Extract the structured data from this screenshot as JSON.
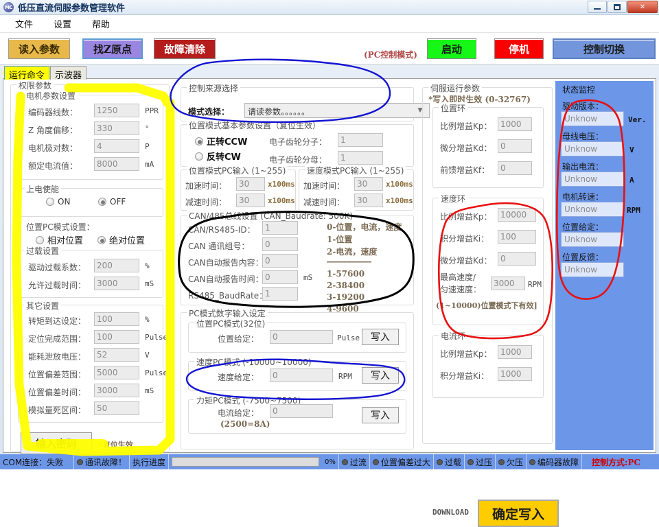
{
  "window": {
    "title": "低压直流伺服参数管理软件",
    "icon": "app-icon",
    "minimize": "–",
    "maximize": "□",
    "close": "✕"
  },
  "menu": {
    "items": [
      "文件",
      "设置",
      "帮助"
    ]
  },
  "toolbar": {
    "read_params": "读入参数",
    "find_z": "找Z原点",
    "fault_clear": "故障清除",
    "pc_mode_note": "(PC控制模式)",
    "start": "启动",
    "stop": "停机",
    "control_switch": "控制切换"
  },
  "tabs": [
    {
      "label": "运行命令",
      "active": true
    },
    {
      "label": "示波器",
      "active": false
    }
  ],
  "left": {
    "outer_caption": "权限参数",
    "motor": {
      "caption": "电机参数设置",
      "rows": [
        {
          "label": "编码器线数：",
          "value": "1250",
          "unit": "PPR"
        },
        {
          "label": "Z 角度偏移：",
          "value": "330",
          "unit": "°"
        },
        {
          "label": "电机极对数：",
          "value": "4",
          "unit": "P"
        },
        {
          "label": "额定电流值：",
          "value": "8000",
          "unit": "mA"
        }
      ]
    },
    "power_enable": {
      "caption": "上电使能",
      "on": "ON",
      "off": "OFF",
      "selected": "OFF",
      "pc_mode_label": "位置PC模式设置：",
      "relative": "相对位置",
      "absolute": "绝对位置",
      "pos_selected": "绝对位置"
    },
    "overload": {
      "caption": "过载设置",
      "rows": [
        {
          "label": "驱动过载系数：",
          "value": "200",
          "unit": "%"
        },
        {
          "label": "允许过载时间：",
          "value": "3000",
          "unit": "mS"
        }
      ]
    },
    "other": {
      "caption": "其它设置",
      "rows": [
        {
          "label": "转矩到达设定：",
          "value": "100",
          "unit": "%"
        },
        {
          "label": "定位完成范围：",
          "value": "100",
          "unit": "Pulse"
        },
        {
          "label": "能耗泄放电压：",
          "value": "52",
          "unit": "V"
        },
        {
          "label": "位置偏差范围：",
          "value": "5000",
          "unit": "Pulse"
        },
        {
          "label": "位置偏差时间：",
          "value": "3000",
          "unit": "mS"
        },
        {
          "label": "模拟量死区间：",
          "value": "50",
          "unit": ""
        }
      ]
    },
    "password_button": "输入密码",
    "password_note": "*复位生效"
  },
  "middle": {
    "source": {
      "caption": "控制来源选择",
      "mode_label": "模式选择：",
      "mode_value": "请读参数。。。。。。"
    },
    "posbasic": {
      "caption": "位置模式基本参数设置（复位生效）",
      "ccw": "正转CCW",
      "cw": "反转CW",
      "selected": "正转CCW",
      "num_label": "电子齿轮分子：",
      "num_value": "1",
      "den_label": "电子齿轮分母：",
      "den_value": "1"
    },
    "pos_pc_input": {
      "caption": "位置模式PC输入 (1~255)",
      "acc_label": "加速时间：",
      "acc_value": "30",
      "acc_unit": "x100ms",
      "dec_label": "减速时间：",
      "dec_value": "30",
      "dec_unit": "x100ms"
    },
    "spd_pc_input": {
      "caption": "速度模式PC输入 (1~255)",
      "acc_label": "加速时间：",
      "acc_value": "30",
      "acc_unit": "x100ms",
      "dec_label": "减速时间：",
      "dec_value": "30",
      "dec_unit": "x100ms"
    },
    "bus": {
      "caption": "CAN/485总线设置 (CAN_Baudrate: 500K)",
      "rows": [
        {
          "label": "CAN/RS485-ID：",
          "value": "1",
          "unit": ""
        },
        {
          "label": "CAN 通讯组号：",
          "value": "0",
          "unit": ""
        },
        {
          "label": "CAN自动报告内容：",
          "value": "0",
          "unit": ""
        },
        {
          "label": "CAN自动报告时间：",
          "value": "0",
          "unit": "mS"
        },
        {
          "label": "RS485_BaudRate：",
          "value": "1",
          "unit": ""
        }
      ],
      "notes_top": [
        "0-位置，电流，速度",
        "1-位置",
        "2-电流，速度"
      ],
      "notes_divider": "—————————",
      "notes_bottom": [
        "1-57600",
        "2-38400",
        "3-19200",
        "4-9600"
      ]
    },
    "pcdigital": {
      "caption": "PC模式数字输入设定",
      "pos": {
        "caption": "位置PC模式(32位)",
        "label": "位置给定：",
        "value": "0",
        "unit": "Pulse",
        "write": "写入"
      },
      "spd": {
        "caption": "速度PC模式 (-10000~10000)",
        "label": "速度给定：",
        "value": "0",
        "unit": "RPM",
        "write": "写入"
      },
      "trq": {
        "caption": "力矩PC模式 (-7500~7500)",
        "label": "电流给定：",
        "value": "0",
        "note": "(2500=8A)",
        "write": "写入"
      }
    }
  },
  "right": {
    "caption": "伺服运行参数",
    "note": "*写入即时生效 (0-32767)",
    "position_loop": {
      "caption": "位置环",
      "rows": [
        {
          "label": "比例增益Kp：",
          "value": "1000"
        },
        {
          "label": "微分增益Kd：",
          "value": "0"
        },
        {
          "label": "前馈增益Kf：",
          "value": "0"
        }
      ]
    },
    "speed_loop": {
      "caption": "速度环",
      "rows": [
        {
          "label": "比例增益Kp：",
          "value": "10000"
        },
        {
          "label": "积分增益Ki：",
          "value": "100"
        },
        {
          "label": "微分增益Kd：",
          "value": "0"
        }
      ],
      "max_label1": "最高速度/",
      "max_label2": "匀速速度：",
      "max_value": "3000",
      "max_unit": "RPM",
      "max_note": "(1~10000)位置模式下有效]"
    },
    "current_loop": {
      "caption": "电流环",
      "rows": [
        {
          "label": "比例增益Kp：",
          "value": "1000"
        },
        {
          "label": "积分增益Ki：",
          "value": "1000"
        }
      ]
    },
    "download_label": "DOWNLOAD",
    "confirm_write": "确定写入"
  },
  "status_monitor": {
    "caption": "状态监控",
    "rows": [
      {
        "label": "驱动版本：",
        "value": "Unknow",
        "unit": "Ver."
      },
      {
        "label": "母线电压：",
        "value": "Unknow",
        "unit": "V"
      },
      {
        "label": "输出电流：",
        "value": "Unknow",
        "unit": "A"
      },
      {
        "label": "电机转速：",
        "value": "Unknow",
        "unit": "RPM"
      },
      {
        "label": "位置给定：",
        "value": "Unknow",
        "unit": ""
      },
      {
        "label": "位置反馈：",
        "value": "Unknow",
        "unit": ""
      }
    ]
  },
  "statusbar": {
    "com": "COM连接：失败",
    "comm_fault": "通讯故障！",
    "progress_label": "执行进度",
    "progress_percent": "0%",
    "leds": [
      "过流",
      "位置偏差过大",
      "过载",
      "过压",
      "欠压",
      "编码器故障"
    ],
    "control_mode": "控制方式:PC"
  },
  "colors": {
    "accent_blue_panel": "#6C96E8",
    "highlight_yellow": "#FFFF00",
    "annot_red": "#E81010",
    "annot_blue": "#1414D2",
    "annot_black": "#000000",
    "start_green": "#17F717",
    "stop_red": "#FA0000",
    "confirm_yellow": "#FFCC00"
  }
}
